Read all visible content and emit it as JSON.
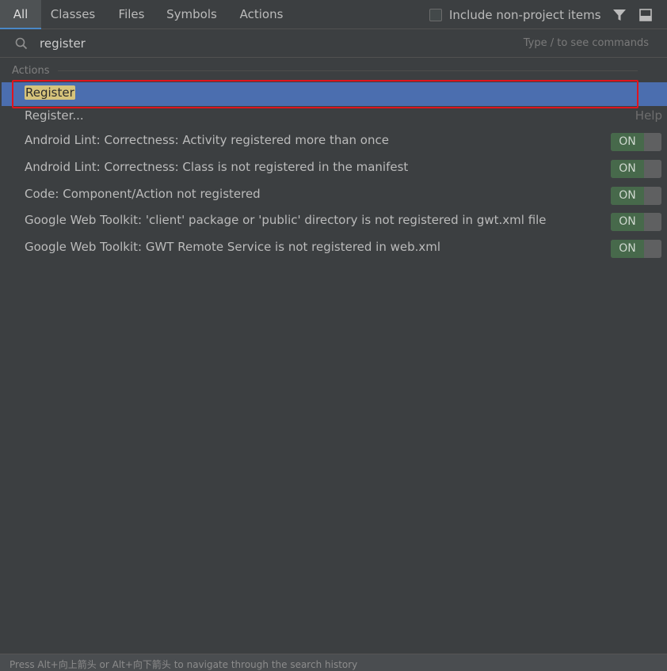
{
  "tabs": [
    {
      "label": "All",
      "active": true
    },
    {
      "label": "Classes"
    },
    {
      "label": "Files"
    },
    {
      "label": "Symbols"
    },
    {
      "label": "Actions"
    }
  ],
  "include_non_project": {
    "label": "Include non-project items",
    "checked": false
  },
  "search": {
    "value": "register",
    "hint": "Type / to see commands"
  },
  "section": {
    "title": "Actions"
  },
  "results": [
    {
      "label": "Register",
      "selected": true
    },
    {
      "label": "Register...",
      "tag": "Help"
    },
    {
      "label": "Android Lint: Correctness: Activity registered more than once",
      "toggle": "ON"
    },
    {
      "label": "Android Lint: Correctness: Class is not registered in the manifest",
      "toggle": "ON"
    },
    {
      "label": "Code: Component/Action not registered",
      "toggle": "ON"
    },
    {
      "label": "Google Web Toolkit: 'client' package or 'public' directory is not registered in gwt.xml file",
      "toggle": "ON"
    },
    {
      "label": "Google Web Toolkit: GWT Remote Service is not registered in web.xml",
      "toggle": "ON"
    }
  ],
  "status": {
    "text": "Press Alt+向上箭头 or Alt+向下箭头 to navigate through the search history"
  },
  "icons": {
    "search": "search-icon",
    "filter": "filter-icon",
    "pin": "pin-window-icon"
  },
  "colors": {
    "selection": "#4b6eaf",
    "match_highlight": "#d6c37b",
    "toggle_on": "#47694b",
    "annotation": "#e0141e"
  }
}
